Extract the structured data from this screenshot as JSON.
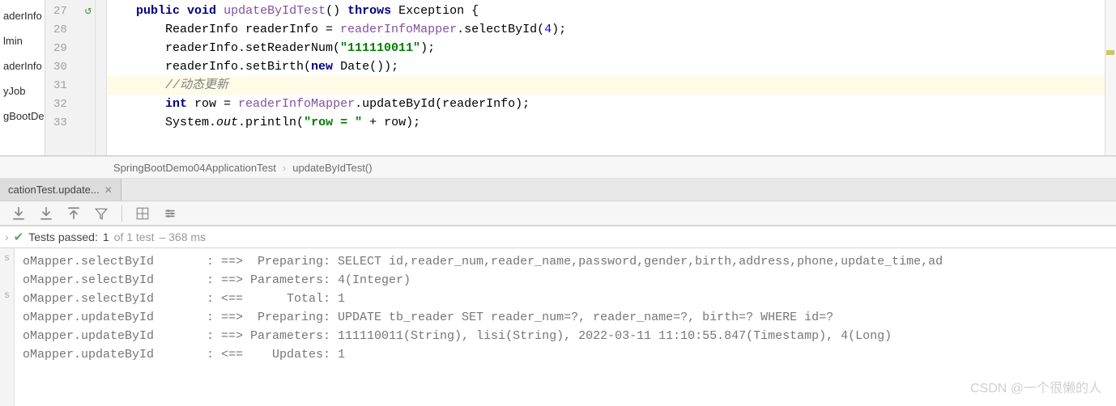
{
  "sidebar": {
    "items": [
      {
        "label": "aderInfo"
      },
      {
        "label": "lmin"
      },
      {
        "label": "aderInfo"
      },
      {
        "label": "yJob"
      },
      {
        "label": "gBootDe"
      }
    ]
  },
  "gutter": {
    "lines": [
      "27",
      "28",
      "29",
      "30",
      "31",
      "32",
      "33"
    ],
    "run_marker_at": 0
  },
  "code": {
    "lines": [
      {
        "n": 27,
        "highlight": false,
        "segments": [
          {
            "t": "    ",
            "c": ""
          },
          {
            "t": "public",
            "c": "kw"
          },
          {
            "t": " ",
            "c": ""
          },
          {
            "t": "void",
            "c": "kw"
          },
          {
            "t": " ",
            "c": ""
          },
          {
            "t": "updateByIdTest",
            "c": "mname"
          },
          {
            "t": "() ",
            "c": ""
          },
          {
            "t": "throws",
            "c": "kw"
          },
          {
            "t": " Exception {",
            "c": ""
          }
        ]
      },
      {
        "n": 28,
        "highlight": false,
        "segments": [
          {
            "t": "        ReaderInfo readerInfo = ",
            "c": ""
          },
          {
            "t": "readerInfoMapper",
            "c": "mname"
          },
          {
            "t": ".selectById(",
            "c": ""
          },
          {
            "t": "4",
            "c": "num"
          },
          {
            "t": ");",
            "c": ""
          }
        ]
      },
      {
        "n": 29,
        "highlight": false,
        "segments": [
          {
            "t": "        readerInfo.setReaderNum(",
            "c": ""
          },
          {
            "t": "\"111110011\"",
            "c": "str"
          },
          {
            "t": ");",
            "c": ""
          }
        ]
      },
      {
        "n": 30,
        "highlight": false,
        "segments": [
          {
            "t": "        readerInfo.setBirth(",
            "c": ""
          },
          {
            "t": "new",
            "c": "kw"
          },
          {
            "t": " Date());",
            "c": ""
          }
        ]
      },
      {
        "n": 31,
        "highlight": true,
        "segments": [
          {
            "t": "        ",
            "c": ""
          },
          {
            "t": "//动态更新",
            "c": "cmt"
          }
        ]
      },
      {
        "n": 32,
        "highlight": false,
        "segments": [
          {
            "t": "        ",
            "c": ""
          },
          {
            "t": "int",
            "c": "kw"
          },
          {
            "t": " row = ",
            "c": ""
          },
          {
            "t": "readerInfoMapper",
            "c": "mname"
          },
          {
            "t": ".updateById(readerInfo);",
            "c": ""
          }
        ]
      },
      {
        "n": 33,
        "highlight": false,
        "segments": [
          {
            "t": "        System.",
            "c": ""
          },
          {
            "t": "out",
            "c": "it"
          },
          {
            "t": ".println(",
            "c": ""
          },
          {
            "t": "\"row = \"",
            "c": "str"
          },
          {
            "t": " + row);",
            "c": ""
          }
        ]
      }
    ]
  },
  "breadcrumb": {
    "class": "SpringBootDemo04ApplicationTest",
    "method": "updateByIdTest()"
  },
  "runtab": {
    "label": "cationTest.update..."
  },
  "teststatus": {
    "prefix": "Tests passed:",
    "passed": "1",
    "of_tests": "of 1 test",
    "duration": "– 368 ms"
  },
  "console": {
    "rows": [
      {
        "g": "s",
        "src": "oMapper.selectById",
        "dir": "==>",
        "body": "  Preparing: SELECT id,reader_num,reader_name,password,gender,birth,address,phone,update_time,ad"
      },
      {
        "g": "",
        "src": "oMapper.selectById",
        "dir": "==>",
        "body": " Parameters: 4(Integer)"
      },
      {
        "g": "s",
        "src": "oMapper.selectById",
        "dir": "<==",
        "body": "      Total: 1"
      },
      {
        "g": "",
        "src": "oMapper.updateById",
        "dir": "==>",
        "body": "  Preparing: UPDATE tb_reader SET reader_num=?, reader_name=?, birth=? WHERE id=?"
      },
      {
        "g": "",
        "src": "oMapper.updateById",
        "dir": "==>",
        "body": " Parameters: 111110011(String), lisi(String), 2022-03-11 11:10:55.847(Timestamp), 4(Long)"
      },
      {
        "g": "",
        "src": "oMapper.updateById",
        "dir": "<==",
        "body": "    Updates: 1"
      }
    ]
  },
  "watermark": "CSDN @一个很懒的人"
}
